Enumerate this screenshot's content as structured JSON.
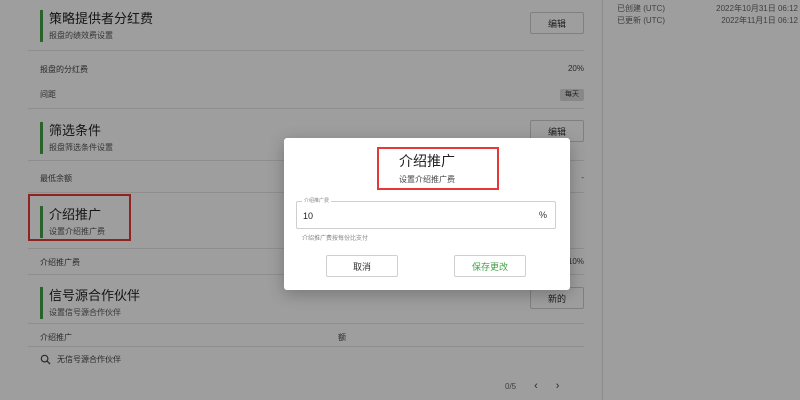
{
  "sidebar_meta": [
    {
      "label": "已创建 (UTC)",
      "value": "2022年10月31日 06:12"
    },
    {
      "label": "已更新 (UTC)",
      "value": "2022年11月1日 06:12"
    }
  ],
  "sections": {
    "strategy_fee": {
      "title": "策略提供者分红费",
      "subtitle": "报盘的绩效费设置",
      "edit_label": "编辑",
      "rows": [
        {
          "label": "报盘的分红费",
          "value": "20%"
        },
        {
          "label": "间距",
          "badge": "每天"
        }
      ]
    },
    "filter": {
      "title": "筛选条件",
      "subtitle": "报盘筛选条件设置",
      "edit_label": "编辑",
      "rows": [
        {
          "label": "最低余额",
          "value": "-"
        }
      ]
    },
    "referral": {
      "title": "介绍推广",
      "subtitle": "设置介绍推广费",
      "rows": [
        {
          "label": "介绍推广费",
          "value": "10%"
        }
      ]
    },
    "partners": {
      "title": "信号源合作伙伴",
      "subtitle": "设置信号源合作伙伴",
      "new_label": "新的",
      "table_headers": [
        "介绍推广",
        "额"
      ],
      "empty_text": "无信号源合作伙伴",
      "pager_text": "0/5"
    }
  },
  "modal": {
    "title": "介绍推广",
    "subtitle": "设置介绍推广费",
    "field_label": "介绍推广费",
    "field_value": "10",
    "field_unit": "%",
    "help_text": "介绍推广费按每份比支付",
    "cancel_label": "取消",
    "save_label": "保存更改"
  },
  "colors": {
    "accent_green": "#43a047",
    "highlight_red": "#e53935"
  },
  "icons": {
    "empty_search": "search-icon",
    "prev": "chevron-left-icon",
    "next": "chevron-right-icon"
  }
}
